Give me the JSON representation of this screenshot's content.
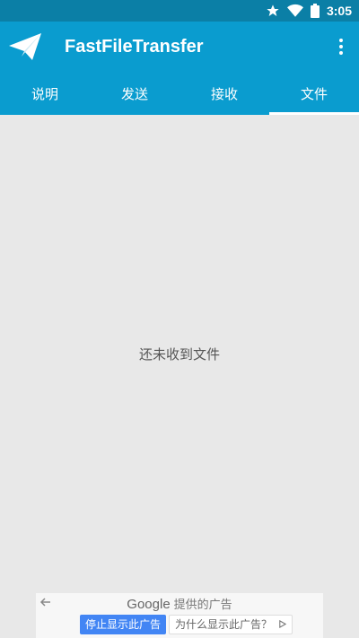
{
  "status_bar": {
    "time": "3:05",
    "icons": [
      "star-icon",
      "wifi-icon",
      "battery-icon"
    ]
  },
  "app_bar": {
    "title": "FastFileTransfer",
    "logo_icon": "paper-plane-icon",
    "menu_icon": "more-vert-icon"
  },
  "tabs": [
    {
      "label": "说明",
      "active": false
    },
    {
      "label": "发送",
      "active": false
    },
    {
      "label": "接收",
      "active": false
    },
    {
      "label": "文件",
      "active": true
    }
  ],
  "main": {
    "empty_message": "还未收到文件"
  },
  "ad_banner": {
    "provider": "Google",
    "provided_text": "提供的广告",
    "stop_button": "停止显示此广告",
    "why_button": "为什么显示此广告？"
  },
  "colors": {
    "status_bar": "#0b7fa6",
    "app_bar": "#0a9ccf",
    "background": "#e8e8e8",
    "ad_button": "#4285f4"
  }
}
